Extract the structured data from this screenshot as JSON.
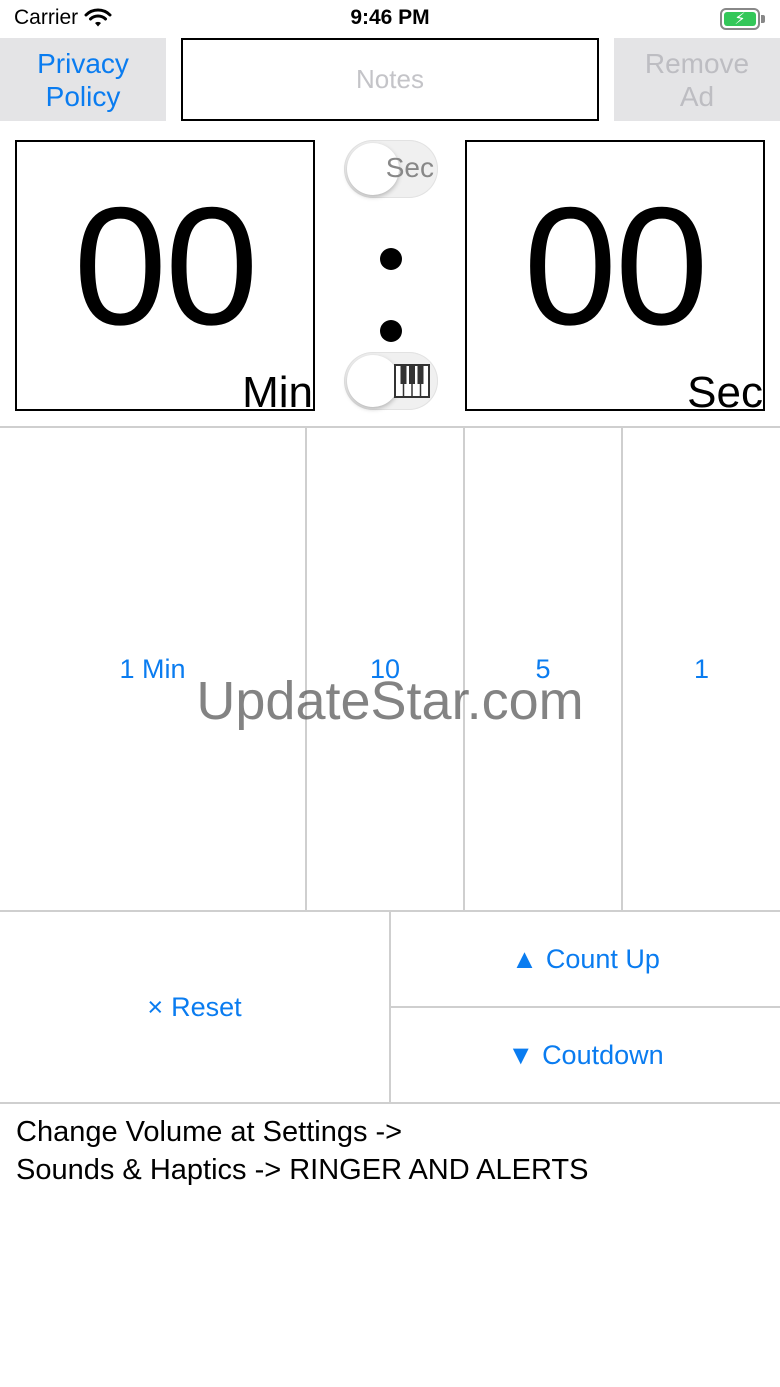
{
  "status_bar": {
    "carrier": "Carrier",
    "time": "9:46 PM",
    "wifi_icon": "wifi-icon",
    "battery_icon": "battery-charging-icon"
  },
  "top": {
    "privacy_label_line1": "Privacy",
    "privacy_label_line2": "Policy",
    "notes_placeholder": "Notes",
    "remove_ad_line1": "Remove",
    "remove_ad_line2": "Ad"
  },
  "timer": {
    "minutes": "00",
    "minutes_unit": "Min",
    "seconds": "00",
    "seconds_unit": "Sec",
    "toggle_sec_label": "Sec",
    "toggle_sound_icon": "piano-icon"
  },
  "presets": [
    {
      "label": "1 Min"
    },
    {
      "label": "10"
    },
    {
      "label": "5"
    },
    {
      "label": "1"
    }
  ],
  "actions": {
    "reset_icon": "×",
    "reset_label": "Reset",
    "count_up_icon": "▲",
    "count_up_label": "Count Up",
    "countdown_icon": "▼",
    "countdown_label": "Coutdown"
  },
  "info": {
    "line1": "Change Volume at Settings ->",
    "line2": "Sounds & Haptics -> RINGER AND ALERTS"
  },
  "watermark": "UpdateStar.com",
  "colors": {
    "accent": "#0a7cf0",
    "disabled": "#bdbdc2",
    "button_bg": "#e4e4e6",
    "battery": "#34c759"
  }
}
